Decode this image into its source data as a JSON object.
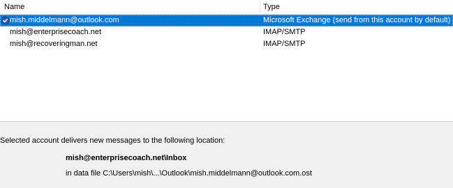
{
  "accounts_list": {
    "columns": {
      "name": "Name",
      "type": "Type"
    },
    "rows": [
      {
        "name": "mish.middelmann@outlook.com",
        "type": "Microsoft Exchange (send from this account by default)",
        "default": true,
        "selected": true,
        "icon": "default-check-icon"
      },
      {
        "name": "mish@enterprisecoach.net",
        "type": "IMAP/SMTP",
        "default": false,
        "selected": false
      },
      {
        "name": "mish@recoveringman.net",
        "type": "IMAP/SMTP",
        "default": false,
        "selected": false
      }
    ]
  },
  "delivery": {
    "description": "Selected account delivers new messages to the following location:",
    "location": "mish@enterprisecoach.net\\Inbox",
    "data_file": "in data file C:\\Users\\mish\\...\\Outlook\\mish.middelmann@outlook.com.ost"
  },
  "colors": {
    "selection": "#0078d7",
    "list_background": "#ffffff",
    "panel_background": "#f0f0f0"
  }
}
